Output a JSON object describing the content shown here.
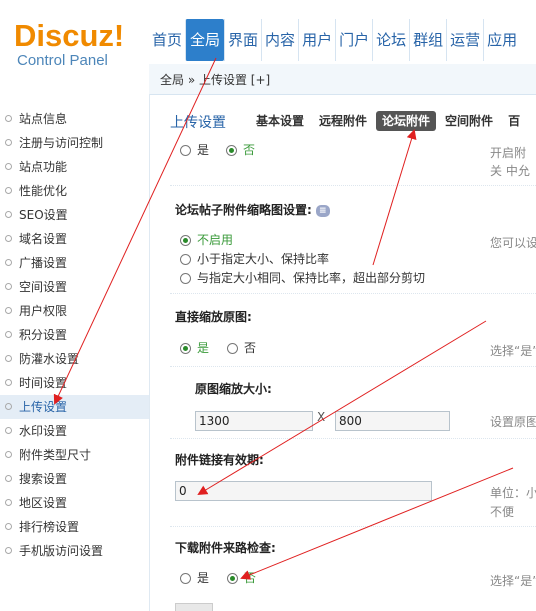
{
  "logo": {
    "brand": "Discuz!",
    "subtitle": "Control Panel"
  },
  "nav": {
    "items": [
      "首页",
      "全局",
      "界面",
      "内容",
      "用户",
      "门户",
      "论坛",
      "群组",
      "运营",
      "应用"
    ],
    "active_index": 1
  },
  "crumb": "全局 » 上传设置 [+]",
  "sidebar": {
    "items": [
      "站点信息",
      "注册与访问控制",
      "站点功能",
      "性能优化",
      "SEO设置",
      "域名设置",
      "广播设置",
      "空间设置",
      "用户权限",
      "积分设置",
      "防灌水设置",
      "时间设置",
      "上传设置",
      "水印设置",
      "附件类型尺寸",
      "搜索设置",
      "地区设置",
      "排行榜设置",
      "手机版访问设置"
    ],
    "active_index": 12
  },
  "page": {
    "title": "上传设置",
    "tabs": [
      "基本设置",
      "远程附件",
      "论坛附件",
      "空间附件",
      "百"
    ],
    "active_tab": 2
  },
  "settings": {
    "top_row": {
      "yes": "是",
      "no": "否",
      "hint1": "开启附",
      "hint2": "关 中允"
    },
    "thumb": {
      "title": "论坛帖子附件缩略图设置:",
      "opt1": "不启用",
      "opt2": "小于指定大小、保持比率",
      "opt3": "与指定大小相同、保持比率，超出部分剪切",
      "hint": "您可以设"
    },
    "resize": {
      "title": "直接缩放原图:",
      "yes": "是",
      "no": "否",
      "hint": "选择“是”"
    },
    "size": {
      "title": "原图缩放大小:",
      "width": "1300",
      "x": "X",
      "height": "800",
      "hint": "设置原图"
    },
    "link": {
      "title": "附件链接有效期:",
      "value": "0",
      "hint1": "单位：小",
      "hint2": "不便"
    },
    "referer": {
      "title": "下载附件来路检查:",
      "yes": "是",
      "no": "否",
      "hint": "选择“是”"
    }
  },
  "colors": {
    "accent": "#2d7fcb",
    "logo": "#f08a00",
    "arrow": "#e02020"
  }
}
